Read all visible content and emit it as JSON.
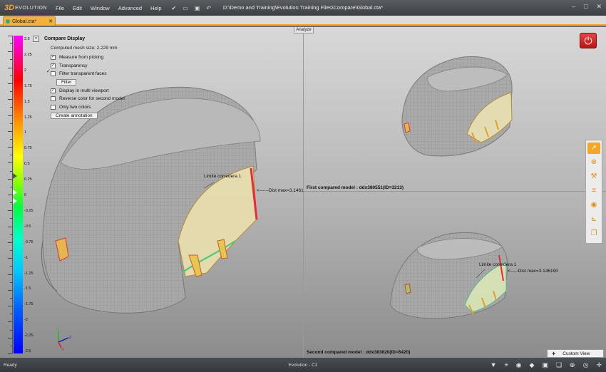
{
  "app": {
    "title": "D:\\Demo and Training\\Evolution Training Files\\Compare\\Global.cta*",
    "logo_3d": "3D",
    "logo_text": "EVOLUTION"
  },
  "menu": [
    "File",
    "Edit",
    "Window",
    "Advanced",
    "Help"
  ],
  "toolbar_icons": [
    "check-icon",
    "open-folder-icon",
    "save-icon",
    "undo-icon"
  ],
  "window_controls": [
    "minimize-icon",
    "maximize-icon",
    "close-icon"
  ],
  "tab": {
    "label": "Global.cta*"
  },
  "viewport": {
    "analyze_label": "Analyze"
  },
  "scale": {
    "labels": [
      "2.5",
      "2.25",
      "2",
      "1.75",
      "1.5",
      "1.25",
      "1",
      "0.75",
      "0.5",
      "0.25",
      "0",
      "-0.25",
      "-0.5",
      "-0.75",
      "-1",
      "-1.25",
      "-1.5",
      "-1.75",
      "-2",
      "-2.25",
      "-2.5"
    ]
  },
  "panel": {
    "title": "Compare Display",
    "mesh_size": "Computed mesh size: 2.229 mm",
    "options": [
      {
        "label": "Measure from picking",
        "checked": true
      },
      {
        "label": "Transparency",
        "checked": true
      },
      {
        "label": "Filter transparent faces",
        "checked": false
      }
    ],
    "filter_button": "Filter",
    "options2": [
      {
        "label": "Display in multi viewport",
        "checked": true
      },
      {
        "label": "Reverse color for second model",
        "checked": false
      },
      {
        "label": "Only two colors",
        "checked": false
      }
    ],
    "annotation_button": "Create annotation"
  },
  "annotations": {
    "left_limit": "Limite corredera 1",
    "left_dist": "<------Dist max=3.1461",
    "top_right_caption": "First compared model : ddx380551(ID=3213)",
    "bottom_right_limit": "Limite corredera 1",
    "bottom_right_dist": "<-----Dist max=3.146190",
    "bottom_right_caption": "Second compared model : ddx383620(ID=6420)"
  },
  "right_toolbar": [
    "select-arrow-icon",
    "cancel-circle-icon",
    "hammer-icon",
    "align-icon",
    "shading-icon",
    "measure-icon",
    "copy-icon"
  ],
  "custom_view": {
    "label": "Custom View"
  },
  "status": {
    "left": "Ready",
    "center": "Evolution - C1"
  },
  "status_icons": [
    "filter-icon",
    "pick-icon",
    "eye-icon",
    "cube-icon",
    "box-icon",
    "layers-icon",
    "globe-icon",
    "target-icon",
    "crosshair-icon"
  ]
}
